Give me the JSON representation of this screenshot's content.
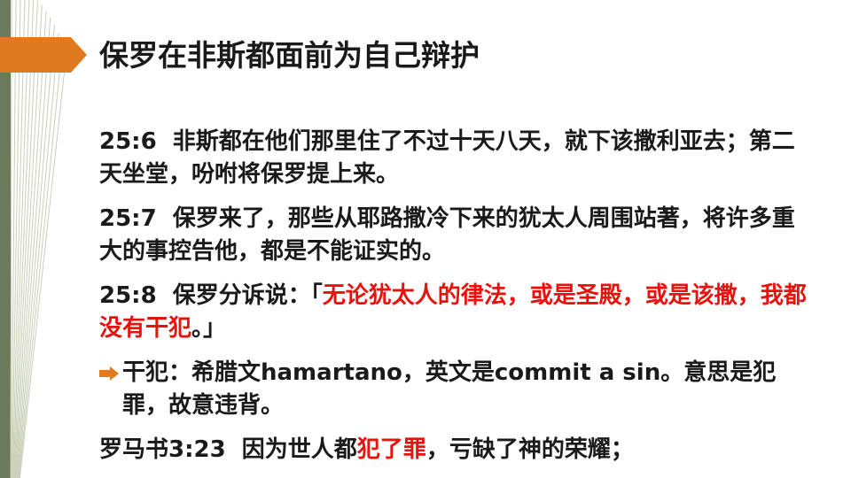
{
  "colors": {
    "accent_orange": "#e07a1f",
    "left_bar": "#6b7a5a",
    "deco_stroke": "#c9cfb8",
    "text": "#1a1a1a",
    "highlight_red": "#e8120c"
  },
  "slide": {
    "title": "保罗在非斯都面前为自己辩护",
    "verses": [
      {
        "ref": "25:6",
        "text": "非斯都在他们那里住了不过十天八天，就下该撒利亚去；第二天坐堂，吩咐将保罗提上来。"
      },
      {
        "ref": "25:7",
        "text": "保罗来了，那些从耶路撒冷下来的犹太人周围站著，将许多重大的事控告他，都是不能证实的。"
      },
      {
        "ref": "25:8",
        "text_before": "保罗分诉说：「",
        "text_red": "无论犹太人的律法，或是圣殿，或是该撒，我都没有干犯",
        "text_after": "。」"
      }
    ],
    "bullet": {
      "icon": "arrow-right-icon",
      "text": "干犯：希腊文hamartano，英文是commit a sin。意思是犯罪，故意违背。"
    },
    "footer_verse": {
      "ref": "罗马书3:23",
      "text_before": "因为世人都",
      "text_red": "犯了罪",
      "text_after": "，亏缺了神的荣耀；"
    }
  }
}
